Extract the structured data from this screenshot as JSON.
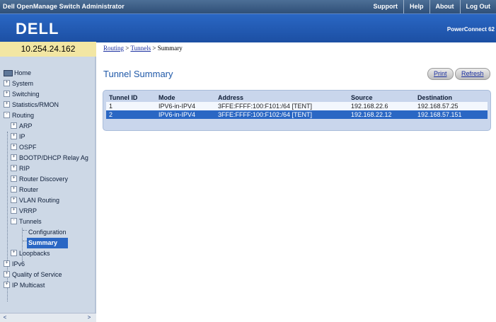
{
  "window": {
    "app_title": "Dell OpenManage Switch Administrator",
    "links": [
      "Support",
      "Help",
      "About",
      "Log Out"
    ]
  },
  "brand": {
    "logo": "DELL",
    "product": "PowerConnect 62"
  },
  "ip_address": "10.254.24.162",
  "breadcrumb": {
    "items": [
      "Routing",
      "Tunnels",
      "Summary"
    ],
    "separator": " > "
  },
  "nav": {
    "items": [
      {
        "label": "Home",
        "level": 0
      },
      {
        "label": "System",
        "level": 0,
        "expander": "+"
      },
      {
        "label": "Switching",
        "level": 0,
        "expander": "+"
      },
      {
        "label": "Statistics/RMON",
        "level": 0,
        "expander": "+"
      },
      {
        "label": "Routing",
        "level": 0,
        "expander": "-"
      },
      {
        "label": "ARP",
        "level": 1,
        "expander": "+"
      },
      {
        "label": "IP",
        "level": 1,
        "expander": "+"
      },
      {
        "label": "OSPF",
        "level": 1,
        "expander": "+"
      },
      {
        "label": "BOOTP/DHCP Relay Ag",
        "level": 1,
        "expander": "+"
      },
      {
        "label": "RIP",
        "level": 1,
        "expander": "+"
      },
      {
        "label": "Router Discovery",
        "level": 1,
        "expander": "+"
      },
      {
        "label": "Router",
        "level": 1,
        "expander": "+"
      },
      {
        "label": "VLAN Routing",
        "level": 1,
        "expander": "+"
      },
      {
        "label": "VRRP",
        "level": 1,
        "expander": "+"
      },
      {
        "label": "Tunnels",
        "level": 1,
        "expander": "-"
      },
      {
        "label": "Configuration",
        "level": 2
      },
      {
        "label": "Summary",
        "level": 2,
        "selected": true
      },
      {
        "label": "Loopbacks",
        "level": 1,
        "expander": "+"
      },
      {
        "label": "IPv6",
        "level": 0,
        "expander": "+"
      },
      {
        "label": "Quality of Service",
        "level": 0,
        "expander": "+"
      },
      {
        "label": "IP Multicast",
        "level": 0,
        "expander": "+"
      }
    ],
    "scroll_left": "<",
    "scroll_right": ">"
  },
  "main": {
    "title": "Tunnel Summary",
    "print_label": "Print",
    "refresh_label": "Refresh",
    "table": {
      "headers": [
        "Tunnel ID",
        "Mode",
        "Address",
        "Source",
        "Destination"
      ],
      "rows": [
        [
          "1",
          "IPV6-in-IPV4",
          "3FFE:FFFF:100:F101:/64 [TENT]",
          "192.168.22.6",
          "192.168.57.25"
        ],
        [
          "2",
          "IPV6-in-IPV4",
          "3FFE:FFFF:100:F102:/64 [TENT]",
          "192.168.22.12",
          "192.168.57.151"
        ]
      ]
    }
  },
  "colors": {
    "title_bar": "#3a5b85",
    "brand_bar": "#2a67c4",
    "ip_box": "#f2e6a3",
    "sidebar": "#cdd8e6",
    "accent": "#1f58a8",
    "selected_row": "#2a67c4"
  }
}
